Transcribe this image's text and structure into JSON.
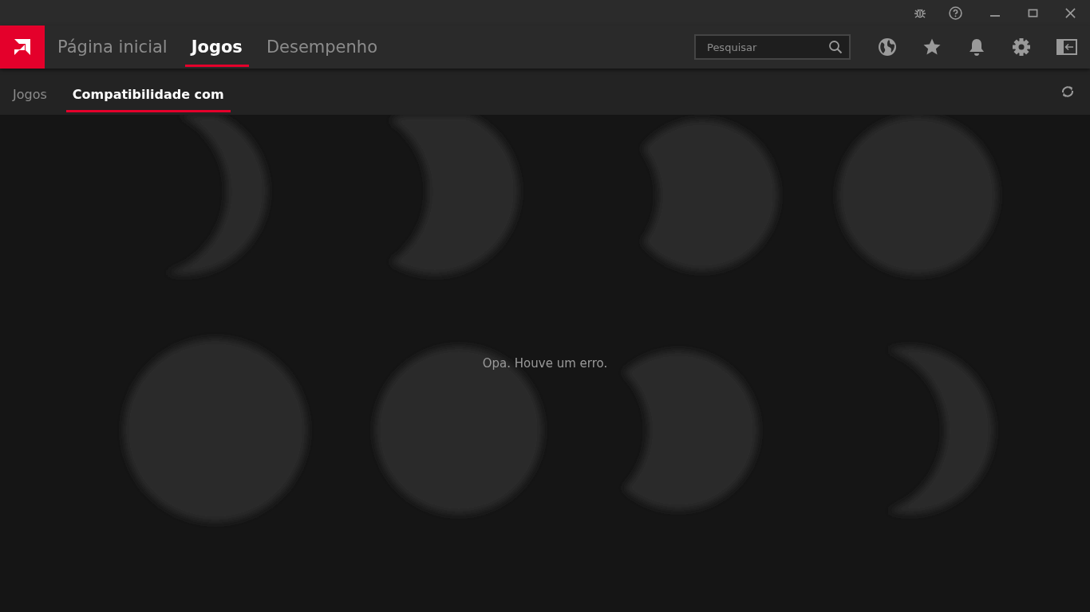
{
  "main_tabs": [
    {
      "label": "Página inicial",
      "selected": false
    },
    {
      "label": "Jogos",
      "selected": true
    },
    {
      "label": "Desempenho",
      "selected": false
    }
  ],
  "search": {
    "placeholder": "Pesquisar"
  },
  "sub_tabs": [
    {
      "label": "Jogos",
      "selected": false
    },
    {
      "label": "Compatibilidade com",
      "selected": true
    }
  ],
  "content": {
    "kind": "picture",
    "message": "Opa. Houve um erro."
  }
}
